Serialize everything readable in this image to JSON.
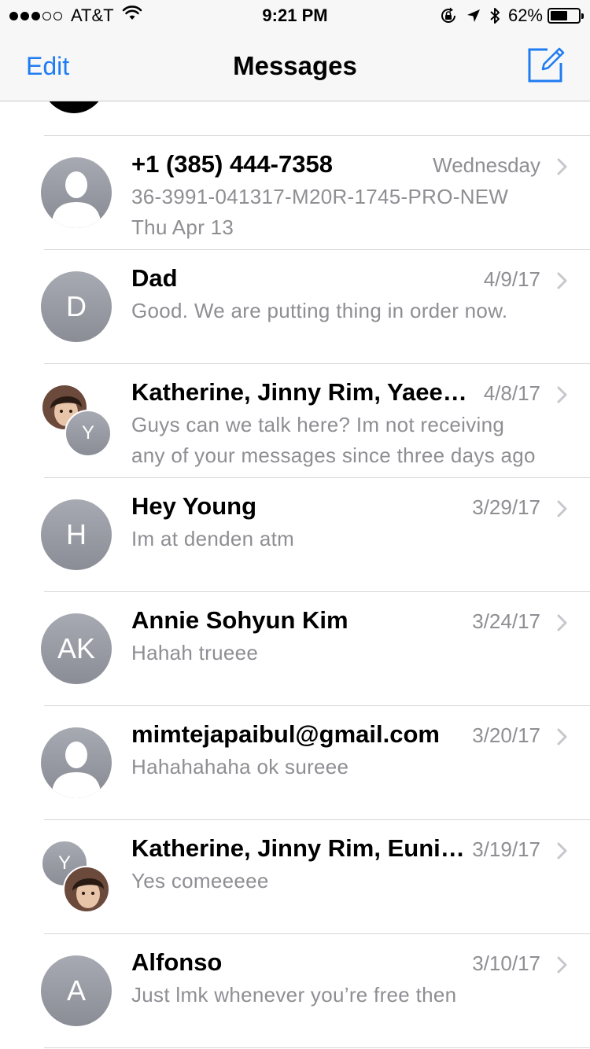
{
  "status_bar": {
    "carrier": "AT&T",
    "time": "9:21 PM",
    "battery_percent": "62%",
    "battery_level": 0.62,
    "signal_bars": 3,
    "signal_total": 5,
    "icons": [
      "wifi-icon",
      "rotation-lock-icon",
      "location-arrow-icon",
      "bluetooth-icon",
      "battery-icon"
    ]
  },
  "nav": {
    "edit_label": "Edit",
    "title": "Messages",
    "compose_icon": "compose-icon",
    "accent_color": "#1f7cf2"
  },
  "conversations": [
    {
      "name": "+1 (385) 444-7358",
      "date": "Wednesday",
      "preview_lines": [
        "36-3991-041317-M20R-1745-PRO-NEW",
        "Thu Apr 13"
      ],
      "avatar": {
        "type": "silhouette",
        "icon": "person-silhouette-icon"
      }
    },
    {
      "name": "Dad",
      "date": "4/9/17",
      "preview_lines": [
        "Good. We are putting thing in order now."
      ],
      "avatar": {
        "type": "initials",
        "text": "D"
      }
    },
    {
      "name": "Katherine, Jinny Rim, Yaeeun Kim",
      "date": "4/8/17",
      "preview_lines": [
        "Guys can we talk here? Im not receiving",
        "any of your messages since three days ago"
      ],
      "avatar": {
        "type": "group",
        "photo_icon": "contact-photo-icon",
        "initial": "Y",
        "layout": "photo-top"
      }
    },
    {
      "name": "Hey Young",
      "date": "3/29/17",
      "preview_lines": [
        "Im at denden atm"
      ],
      "avatar": {
        "type": "initials",
        "text": "H"
      }
    },
    {
      "name": "Annie Sohyun Kim",
      "date": "3/24/17",
      "preview_lines": [
        "Hahah trueee"
      ],
      "avatar": {
        "type": "initials",
        "text": "AK"
      }
    },
    {
      "name": "mimtejapaibul@gmail.com",
      "date": "3/20/17",
      "preview_lines": [
        "Hahahahaha ok sureee"
      ],
      "avatar": {
        "type": "silhouette",
        "icon": "person-silhouette-icon"
      }
    },
    {
      "name": "Katherine, Jinny Rim, Eunice Kim",
      "date": "3/19/17",
      "preview_lines": [
        "Yes comeeeee"
      ],
      "avatar": {
        "type": "group",
        "photo_icon": "contact-photo-icon",
        "initial": "Y",
        "layout": "initial-top"
      }
    },
    {
      "name": "Alfonso",
      "date": "3/10/17",
      "preview_lines": [
        "Just lmk whenever you’re free then"
      ],
      "avatar": {
        "type": "initials",
        "text": "A"
      }
    }
  ],
  "chevron_icon": "chevron-right-icon"
}
